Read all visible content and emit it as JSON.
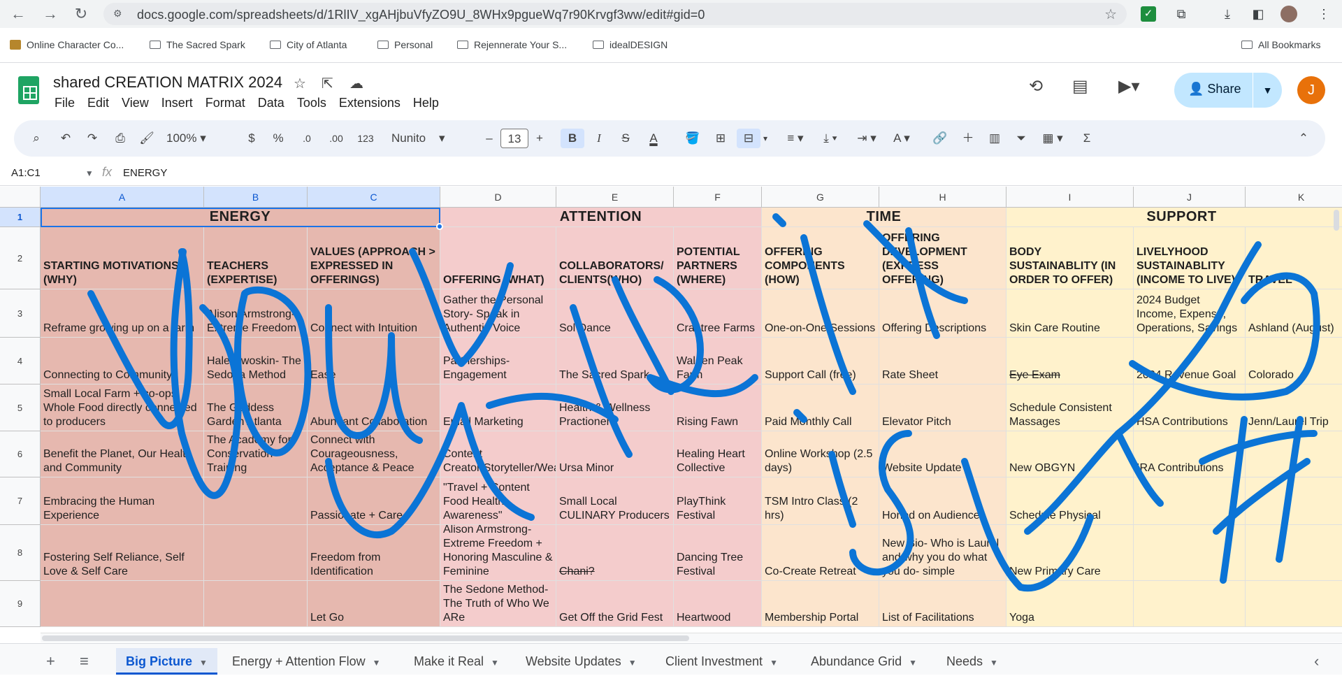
{
  "browser": {
    "url": "docs.google.com/spreadsheets/d/1RlIV_xgAHjbuVfyZO9U_8WHx9pgueWq7r90Krvgf3ww/edit#gid=0",
    "bookmarks": [
      "Online Character Co...",
      "The Sacred Spark",
      "City of Atlanta",
      "Personal",
      "Rejennerate Your S...",
      "idealDESIGN"
    ],
    "all_bookmarks": "All Bookmarks"
  },
  "doc": {
    "title": "shared CREATION MATRIX 2024",
    "menu": [
      "File",
      "Edit",
      "View",
      "Insert",
      "Format",
      "Data",
      "Tools",
      "Extensions",
      "Help"
    ],
    "share_label": "Share",
    "avatar_letter": "J"
  },
  "toolbar": {
    "zoom": "100%",
    "currency": "$",
    "percent": "%",
    "dec_less": ".0",
    "dec_more": ".00",
    "number_format": "123",
    "font": "Nunito",
    "font_size": "13",
    "minus": "–",
    "plus": "+"
  },
  "formula": {
    "name_box": "A1:C1",
    "fx": "fx",
    "value": "ENERGY"
  },
  "columns": [
    "A",
    "B",
    "C",
    "D",
    "E",
    "F",
    "G",
    "H",
    "I",
    "J",
    "K"
  ],
  "rows": [
    "1",
    "2",
    "3",
    "4",
    "5",
    "6",
    "7",
    "8",
    "9"
  ],
  "sheet": {
    "groups": {
      "energy": "ENERGY",
      "attention": "ATTENTION",
      "time": "TIME",
      "support": "SUPPORT"
    },
    "headers": {
      "A": "STARTING MOTIVATIONS (WHY)",
      "B": "TEACHERS (EXPERTISE)",
      "C": "VALUES (APPROACH > EXPRESSED IN OFFERINGS)",
      "D": "OFFERING (WHAT)",
      "E": "COLLABORATORS/ CLIENTS(WHO)",
      "F": "POTENTIAL PARTNERS (WHERE)",
      "G": "OFFERING COMPONENTS (HOW)",
      "H": "OFFERING DEVELOPMENT (EXPRESS OFFERING)",
      "I": "BODY SUSTAINABLITY (IN ORDER TO OFFER)",
      "J": "LIVELYHOOD SUSTAINABLITY (INCOME TO LIVE)",
      "K": "TRAVEL"
    },
    "rows": {
      "r3": {
        "A": "Reframe growing up on a farm",
        "B": "Alison Armstrong- Extreme Freedom",
        "C": "Connect with Intuition",
        "D": "Gather the Personal Story- Speak in Authentic Voice",
        "E": "Sol Dance",
        "F": "Crabtree Farms",
        "G": "One-on-One Sessions",
        "H": "Offering Descriptions",
        "I": "Skin Care Routine",
        "J": "2024 Budget Income, Expense, Operations, Savings",
        "K": "Ashland (August)"
      },
      "r4": {
        "A": "Connecting to Community",
        "B": "Hale Dwoskin- The Sedona Method",
        "C": "Ease",
        "D": "Partnerships- Engagement",
        "E": "The Sacred Spark",
        "F": "Walden Peak Farm",
        "G": "Support Call (free)",
        "H": "Rate Sheet",
        "I": "Eye Exam",
        "J": "2024 Revenue Goal",
        "K": "Colorado"
      },
      "r5": {
        "A": "Small Local Farm + co-ops Whole Food directly connected to producers",
        "B": "The Goddess Garden Atlanta",
        "C": "Abundant Collaboration",
        "D": "Email Marketing",
        "E": "Health & Wellness Practioners",
        "F": "Rising Fawn",
        "G": "Paid Monthly Call",
        "H": "Elevator Pitch",
        "I": "Schedule Consistent Massages",
        "J": "HSA Contributions",
        "K": "Jenn/Laurel Trip"
      },
      "r6": {
        "A": "Benefit the Planet, Our Health and Community",
        "B": "The Academy for Conservation Training",
        "C": "Connect with Courageousness, Acceptance & Peace",
        "D": "Content Creator/Storyteller/Weaver",
        "E": "Ursa Minor",
        "F": "Healing Heart Collective",
        "G": "Online Workshop (2.5 days)",
        "H": "Website Update",
        "I": "New OBGYN",
        "J": "IRA Contributions",
        "K": ""
      },
      "r7": {
        "A": "Embracing the Human Experience",
        "B": "",
        "C": "Passionate + Care",
        "D": "\"Travel + Content Food Health Awareness\"",
        "E": "Small Local CULINARY Producers",
        "F": "PlayThink Festival",
        "G": "TSM Intro Class (2 hrs)",
        "H": "Honed on Audience",
        "I": "Schedule Physical",
        "J": "",
        "K": ""
      },
      "r8": {
        "A": "Fostering Self Reliance, Self Love & Self Care",
        "B": "",
        "C": "Freedom from Identification",
        "D": "Alison Armstrong- Extreme Freedom + Honoring Masculine & Feminine",
        "E": "Chani?",
        "F": "Dancing Tree Festival",
        "G": "Co-Create Retreat",
        "H": "New Bio- Who is Laurel and why you do what you do- simple",
        "I": "New Primary Care",
        "J": "",
        "K": ""
      },
      "r9": {
        "A": "",
        "B": "",
        "C": "Let Go",
        "D": "The Sedone Method- The Truth of Who We ARe",
        "E": "Get Off the Grid Fest",
        "F": "Heartwood",
        "G": "Membership Portal",
        "H": "List of Facilitations",
        "I": "Yoga",
        "J": "",
        "K": ""
      }
    }
  },
  "sheet_tabs": [
    "Big Picture",
    "Energy + Attention Flow",
    "Make it Real",
    "Website Updates",
    "Client Investment",
    "Abundance Grid",
    "Needs"
  ],
  "colors": {
    "energy": "#e6b8af",
    "attention": "#f4cccc",
    "time": "#fce5cd",
    "support": "#fff2cc",
    "scribble": "#0b74d6",
    "selection": "#1a73e8"
  }
}
